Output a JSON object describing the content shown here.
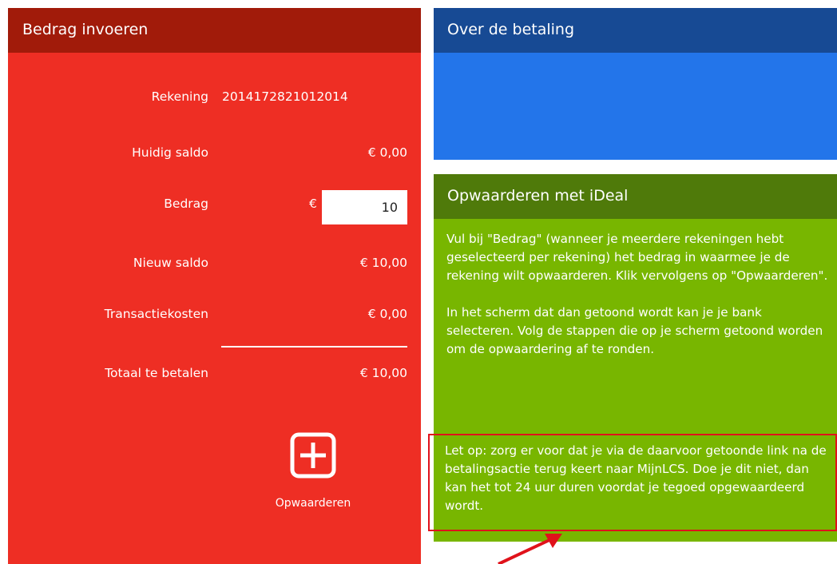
{
  "left": {
    "title": "Bedrag invoeren",
    "rows": {
      "account": {
        "label": "Rekening",
        "value": "2014172821012014"
      },
      "current_balance": {
        "label": "Huidig saldo",
        "value": "€ 0,00"
      },
      "amount": {
        "label": "Bedrag",
        "currency": "€",
        "value": "10"
      },
      "new_balance": {
        "label": "Nieuw saldo",
        "value": "€ 10,00"
      },
      "fees": {
        "label": "Transactiekosten",
        "value": "€ 0,00"
      },
      "total": {
        "label": "Totaal te betalen",
        "value": "€ 10,00"
      }
    },
    "topup_button": {
      "label": "Opwaarderen",
      "icon": "plus-square-icon"
    }
  },
  "about": {
    "title": "Over de betaling"
  },
  "ideal": {
    "title": "Opwaarderen met iDeal",
    "paragraph1": "Vul bij \"Bedrag\" (wanneer je meerdere rekeningen hebt geselecteerd per rekening) het bedrag in waarmee je de rekening wilt opwaarderen. Klik vervolgens op \"Opwaarderen\".",
    "paragraph2": "In het scherm dat dan getoond wordt kan je je bank selecteren. Volg de stappen die op je scherm getoond worden om de opwaardering af te ronden.",
    "notice": "Let op: zorg er voor dat je via de daarvoor getoonde link na de betalingsactie terug keert naar MijnLCS. Doe je dit niet, dan kan het tot 24 uur duren voordat je tegoed opgewaardeerd wordt."
  },
  "colors": {
    "red_panel": "#ee2e24",
    "red_header": "#a11b0a",
    "blue_panel": "#2375ea",
    "blue_header": "#174a94",
    "green_panel": "#78b600",
    "green_header": "#4f7a0a",
    "annotation": "#e0121b"
  }
}
